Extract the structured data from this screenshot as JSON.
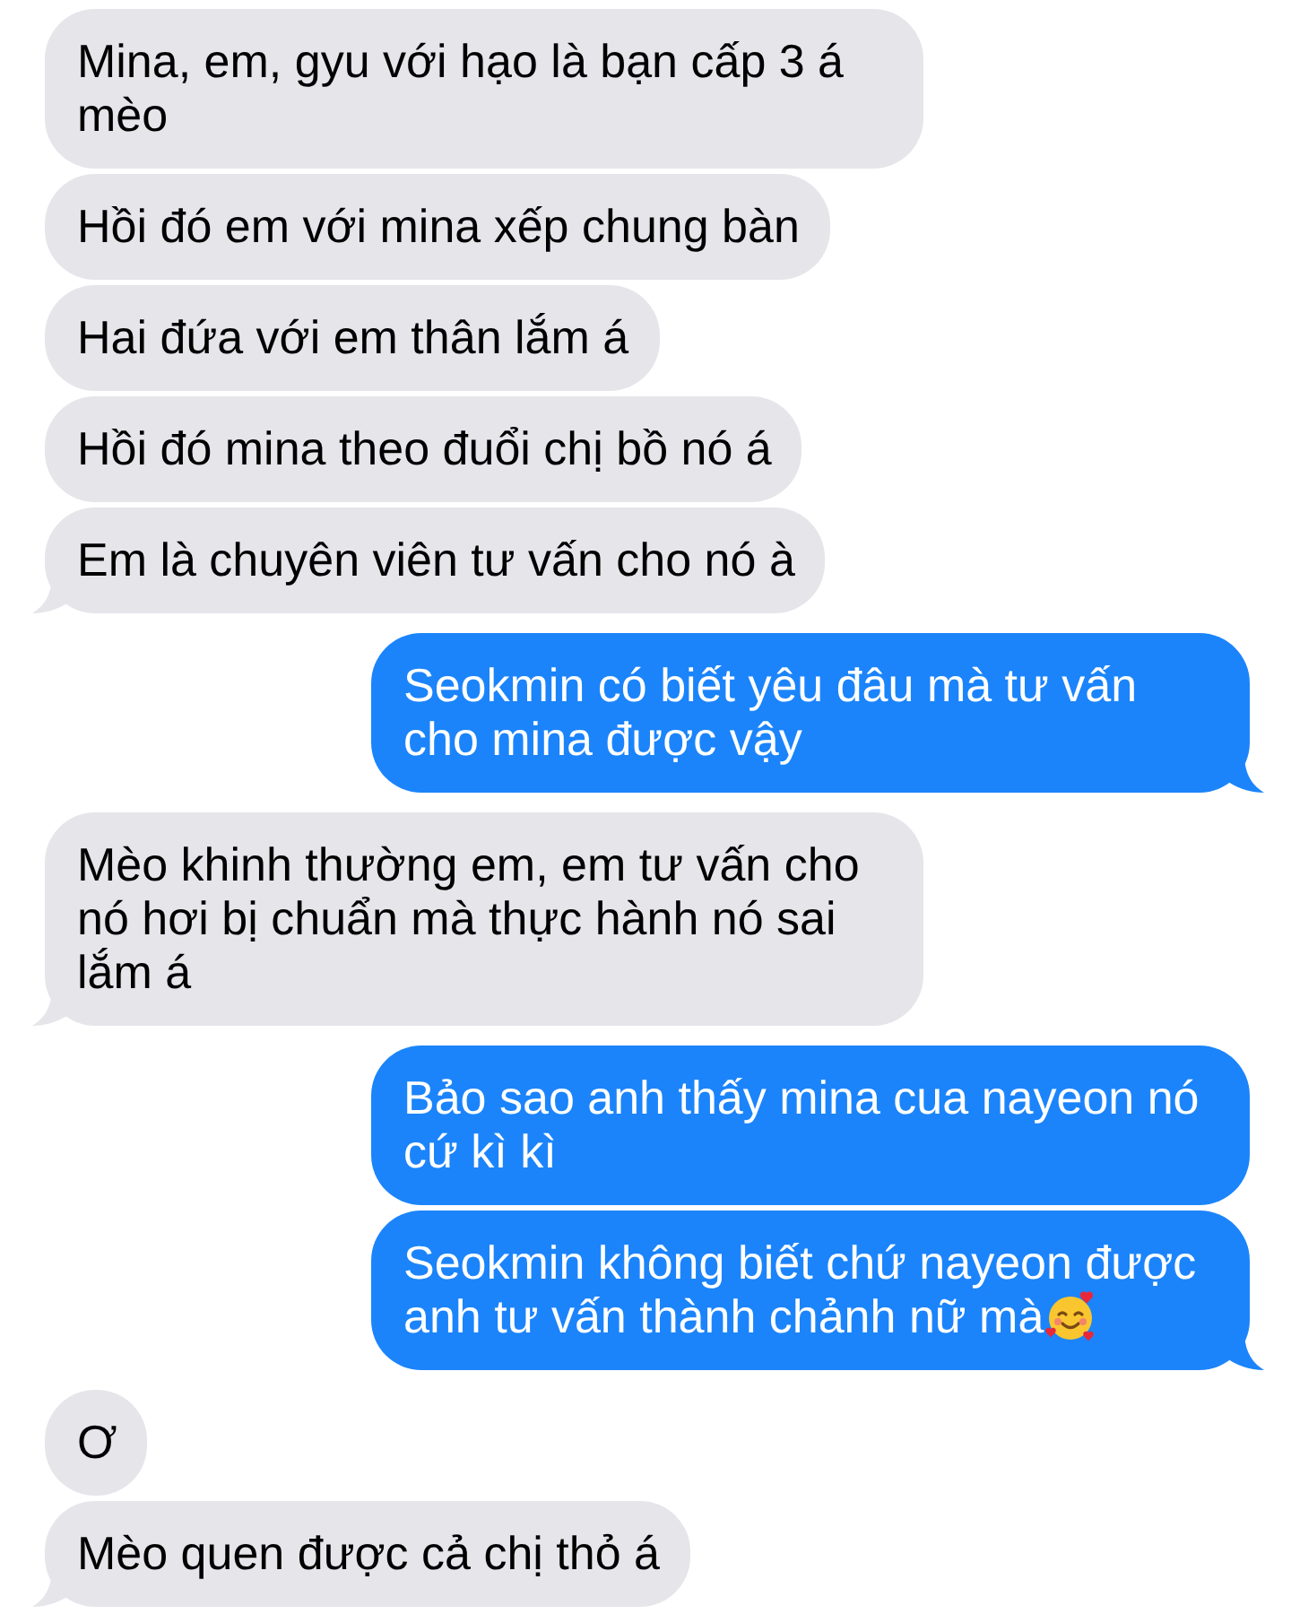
{
  "messages": [
    {
      "kind": "received",
      "text": "Mina, em, gyu với hạo là bạn cấp 3 á mèo",
      "tail": false
    },
    {
      "kind": "received",
      "text": "Hồi đó em với mina xếp chung bàn",
      "tail": false
    },
    {
      "kind": "received",
      "text": "Hai đứa với em thân lắm á",
      "tail": false
    },
    {
      "kind": "received",
      "text": "Hồi đó mina theo đuổi chị bồ nó á",
      "tail": false
    },
    {
      "kind": "received",
      "text": "Em là chuyên viên tư vấn cho nó à",
      "tail": true
    },
    {
      "kind": "sent",
      "text": "Seokmin có biết yêu đâu mà tư vấn cho mina được vậy",
      "tail": true
    },
    {
      "kind": "received",
      "text": "Mèo khinh thường em, em tư vấn cho nó hơi bị chuẩn mà thực hành nó sai lắm á",
      "tail": true
    },
    {
      "kind": "sent",
      "text": "Bảo sao anh thấy mina cua nayeon nó cứ kì kì",
      "tail": false
    },
    {
      "kind": "sent",
      "text": "Seokmin không biết chứ nayeon được anh tư vấn thành chảnh nữ mà",
      "tail": true,
      "trailing_emoji": true
    },
    {
      "kind": "received",
      "text": "Ơ",
      "tail": false
    },
    {
      "kind": "received",
      "text": "Mèo quen được cả chị thỏ á",
      "tail": true
    }
  ]
}
